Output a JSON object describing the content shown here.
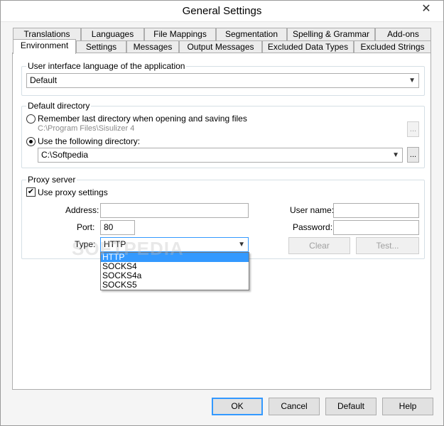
{
  "window": {
    "title": "General Settings",
    "close_glyph": "✕"
  },
  "tabs_row1": [
    {
      "label": "Translations"
    },
    {
      "label": "Languages"
    },
    {
      "label": "File Mappings"
    },
    {
      "label": "Segmentation"
    },
    {
      "label": "Spelling & Grammar"
    },
    {
      "label": "Add-ons"
    }
  ],
  "tabs_row2": [
    {
      "label": "Environment",
      "active": true
    },
    {
      "label": "Settings"
    },
    {
      "label": "Messages"
    },
    {
      "label": "Output Messages"
    },
    {
      "label": "Excluded Data Types"
    },
    {
      "label": "Excluded Strings"
    }
  ],
  "ui_language": {
    "legend": "User interface language of the application",
    "value": "Default"
  },
  "default_directory": {
    "legend": "Default directory",
    "option_remember": "Remember last directory when opening and saving files",
    "remember_path": "C:\\Program Files\\Sisulizer 4",
    "option_following": "Use the following directory:",
    "following_value": "C:\\Softpedia",
    "browse_label": "..."
  },
  "proxy": {
    "legend": "Proxy server",
    "use_proxy_label": "Use proxy settings",
    "use_proxy_checked": true,
    "address_label": "Address:",
    "address_value": "",
    "port_label": "Port:",
    "port_value": "80",
    "type_label": "Type:",
    "type_value": "HTTP",
    "type_options": [
      "HTTP",
      "SOCKS4",
      "SOCKS4a",
      "SOCKS5"
    ],
    "username_label": "User name:",
    "username_value": "",
    "password_label": "Password:",
    "password_value": "",
    "clear_label": "Clear",
    "test_label": "Test..."
  },
  "footer": {
    "ok": "OK",
    "cancel": "Cancel",
    "default": "Default",
    "help": "Help"
  },
  "watermark": "SOFTPEDIA",
  "colors": {
    "accent": "#3399ff",
    "group_border": "#d5dfe5"
  }
}
